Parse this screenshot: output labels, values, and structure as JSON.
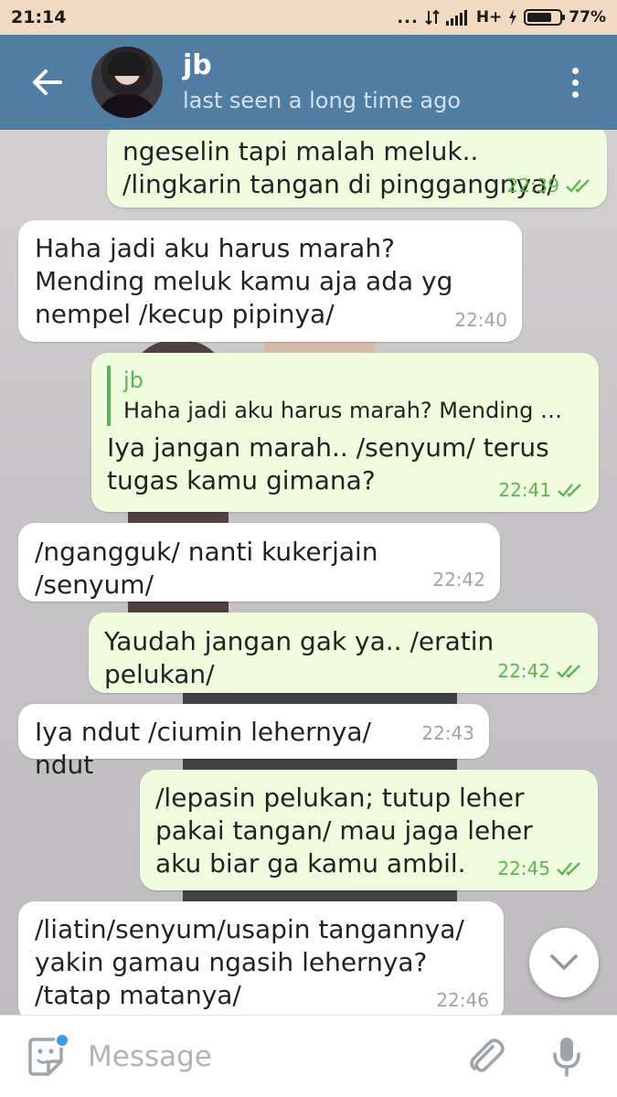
{
  "status_bar": {
    "time": "21:14",
    "indicators": "...",
    "network": "H+",
    "battery_percent": "77%",
    "battery_level": 0.77
  },
  "header": {
    "chat_name": "jb",
    "chat_status": "last seen a long time ago",
    "back_icon": "arrow-left-icon",
    "menu_icon": "vertical-dots-icon"
  },
  "messages": [
    {
      "direction": "out",
      "text": "ngeselin tapi malah meluk.. /lingkarin tangan di pinggangnya/",
      "time": "22:39",
      "read": true
    },
    {
      "direction": "in",
      "text": "Haha jadi aku harus marah? Mending meluk kamu aja ada yg nempel /kecup pipinya/",
      "time": "22:40"
    },
    {
      "direction": "out",
      "reply": {
        "name": "jb",
        "text": "Haha jadi aku harus marah? Mending mel…"
      },
      "text": "Iya jangan marah.. /senyum/ terus tugas kamu gimana?",
      "time": "22:41",
      "read": true
    },
    {
      "direction": "in",
      "text": "/ngangguk/ nanti kukerjain /senyum/",
      "time": "22:42"
    },
    {
      "direction": "out",
      "text": "Yaudah jangan gak ya.. /eratin pelukan/",
      "time": "22:42",
      "read": true
    },
    {
      "direction": "in",
      "text": "Iya ndut /ciumin lehernya/ ndut",
      "time": "22:43"
    },
    {
      "direction": "out",
      "text": "/lepasin pelukan; tutup leher pakai tangan/ mau jaga leher aku biar ga kamu ambil.",
      "time": "22:45",
      "read": true
    },
    {
      "direction": "in",
      "text": "/liatin/senyum/usapin tangannya/ yakin gamau ngasih lehernya? /tatap matanya/",
      "time": "22:46"
    }
  ],
  "input_bar": {
    "placeholder": "Message",
    "value": ""
  },
  "colors": {
    "header": "#527da3",
    "status_bar": "#f2d9c2",
    "outgoing_bubble": "#effdde",
    "incoming_bubble": "#ffffff",
    "read_check": "#5fb356",
    "sticker_dot": "#3a9ce8"
  }
}
